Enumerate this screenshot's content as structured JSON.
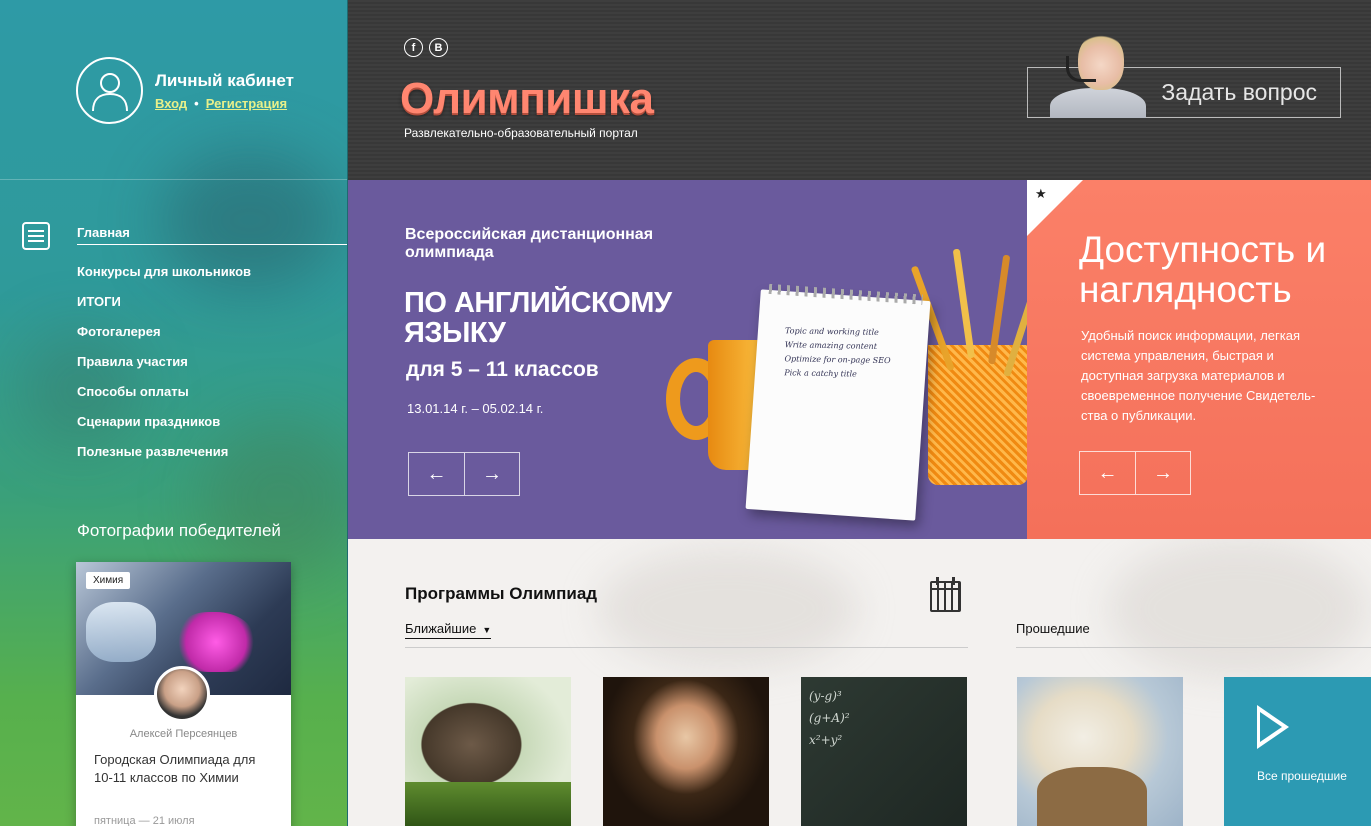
{
  "account": {
    "title": "Личный кабинет",
    "login": "Вход",
    "register": "Регистрация"
  },
  "nav": {
    "items": [
      {
        "label": "Главная"
      },
      {
        "label": "Конкурсы для школьников"
      },
      {
        "label": "ИТОГИ"
      },
      {
        "label": "Фотогалерея"
      },
      {
        "label": "Правила участия"
      },
      {
        "label": "Способы оплаты"
      },
      {
        "label": "Сценарии праздников"
      },
      {
        "label": "Полезные развлечения"
      }
    ]
  },
  "winners": {
    "title": "Фотографии победителей",
    "card": {
      "tag": "Химия",
      "name": "Алексей Персеянцев",
      "description": "Городская Олимпиада для 10-11 классов по Химии",
      "date": "пятница — 21 июля"
    }
  },
  "header": {
    "logo": "Олимпишка",
    "tagline": "Развлекательно-образовательный портал",
    "social": [
      "f",
      "B"
    ],
    "ask_button": "Задать вопрос"
  },
  "banner": {
    "subtitle": "Всероссийская дистанционная олимпиада",
    "title": "ПО АНГЛИЙСКОМУ ЯЗЫКУ",
    "grades": "для 5 – 11 классов",
    "dates": "13.01.14 г. – 05.02.14 г.",
    "notepad_text": [
      "Topic and working title",
      "Write amazing content",
      "Optimize for on-page SEO",
      "Pick a catchy title"
    ]
  },
  "feature": {
    "title": "Доступность и наглядность",
    "text": "Удобный поиск информации, легкая система управления, быстрая и доступная загрузка материалов и своевременное получение Свидетель-ства о публикации."
  },
  "programs": {
    "title": "Программы Олимпиад",
    "tab_upcoming": "Ближайшие",
    "tab_past": "Прошедшие",
    "all_past": "Все прошедшие",
    "chalkboard": [
      "(y-g)³",
      "(g+A)²",
      "x²+y²"
    ]
  },
  "arrows": {
    "prev": "←",
    "next": "→"
  },
  "colors": {
    "sidebar_top": "#2e9aa6",
    "sidebar_bottom": "#62b44a",
    "header_bg": "#3b3b3b",
    "logo": "#ff8670",
    "banner_purple": "#6a5a9d",
    "banner_coral": "#f77862",
    "accent_blue": "#2c9ab3",
    "link_yellow": "#e8f08a"
  }
}
